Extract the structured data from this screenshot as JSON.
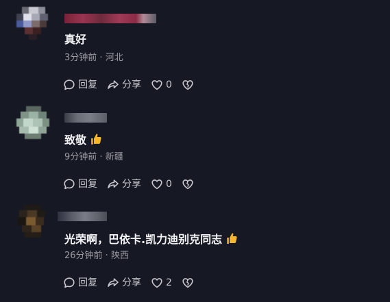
{
  "comments": [
    {
      "text": "真好",
      "has_thumb": false,
      "time": "3分钟前",
      "location": "河北",
      "reply_label": "回复",
      "share_label": "分享",
      "likes": "0"
    },
    {
      "text": "致敬",
      "has_thumb": true,
      "time": "9分钟前",
      "location": "新疆",
      "reply_label": "回复",
      "share_label": "分享",
      "likes": "0"
    },
    {
      "text": "光荣啊，巴依卡.凯力迪别克同志",
      "has_thumb": true,
      "time": "26分钟前",
      "location": "陕西",
      "reply_label": "回复",
      "share_label": "分享",
      "likes": "2"
    }
  ],
  "meta_separator": " · ",
  "icons": {
    "reply": "reply-bubble-icon",
    "share": "share-arrow-icon",
    "like": "heart-icon",
    "dislike": "broken-heart-icon",
    "thumb": "thumbs-up-emoji-icon"
  },
  "colors": {
    "background": "#161823",
    "text": "#f2f2f4",
    "meta": "#9b9ca3",
    "action": "#c9cad0",
    "thumb": "#f5a623",
    "username_blur_1": "#8a2b45",
    "username_blur_2": "#5a5c66"
  }
}
